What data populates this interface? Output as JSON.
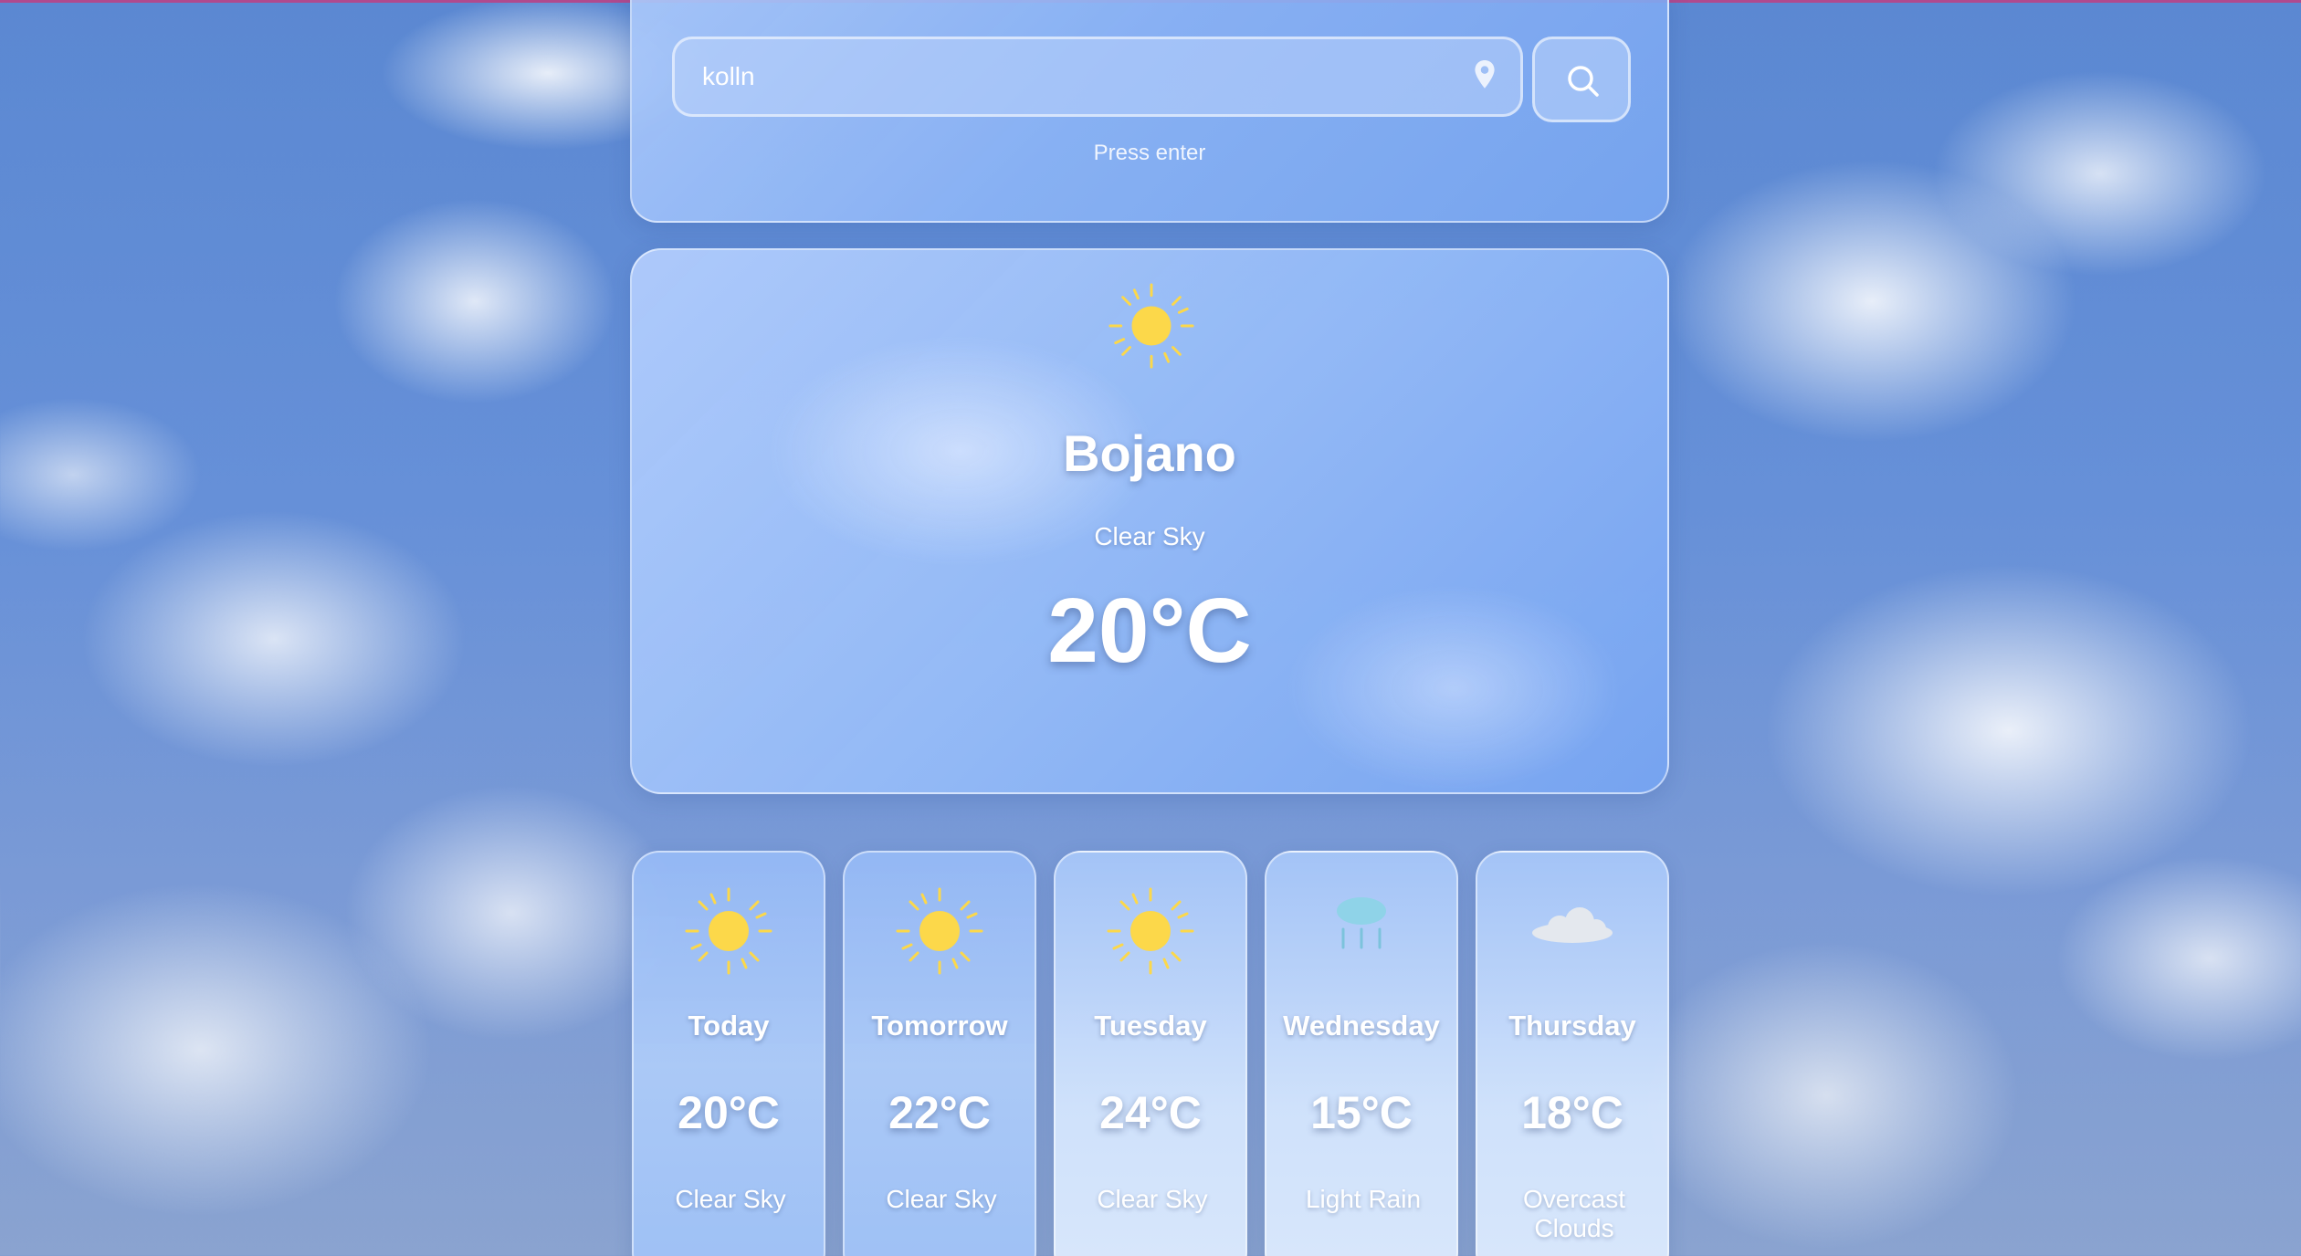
{
  "search": {
    "value": "kolln",
    "placeholder": "",
    "hint": "Press enter",
    "location_icon": "map-pin-icon",
    "search_icon": "magnifier-icon"
  },
  "current": {
    "icon": "sun-icon",
    "city": "Bojano",
    "condition": "Clear Sky",
    "temperature": "20°C"
  },
  "forecast": [
    {
      "day": "Today",
      "temperature": "20°C",
      "condition": "Clear Sky",
      "icon": "sun-icon"
    },
    {
      "day": "Tomorrow",
      "temperature": "22°C",
      "condition": "Clear Sky",
      "icon": "sun-icon"
    },
    {
      "day": "Tuesday",
      "temperature": "24°C",
      "condition": "Clear Sky",
      "icon": "sun-icon"
    },
    {
      "day": "Wednesday",
      "temperature": "15°C",
      "condition": "Light Rain",
      "icon": "rain-icon"
    },
    {
      "day": "Thursday",
      "temperature": "18°C",
      "condition": "Overcast Clouds",
      "icon": "cloud-icon"
    }
  ],
  "colors": {
    "sun": "#fcd84a",
    "rain": "#8fd3e8",
    "cloud": "#e4e8ee",
    "text": "#ffffff"
  }
}
